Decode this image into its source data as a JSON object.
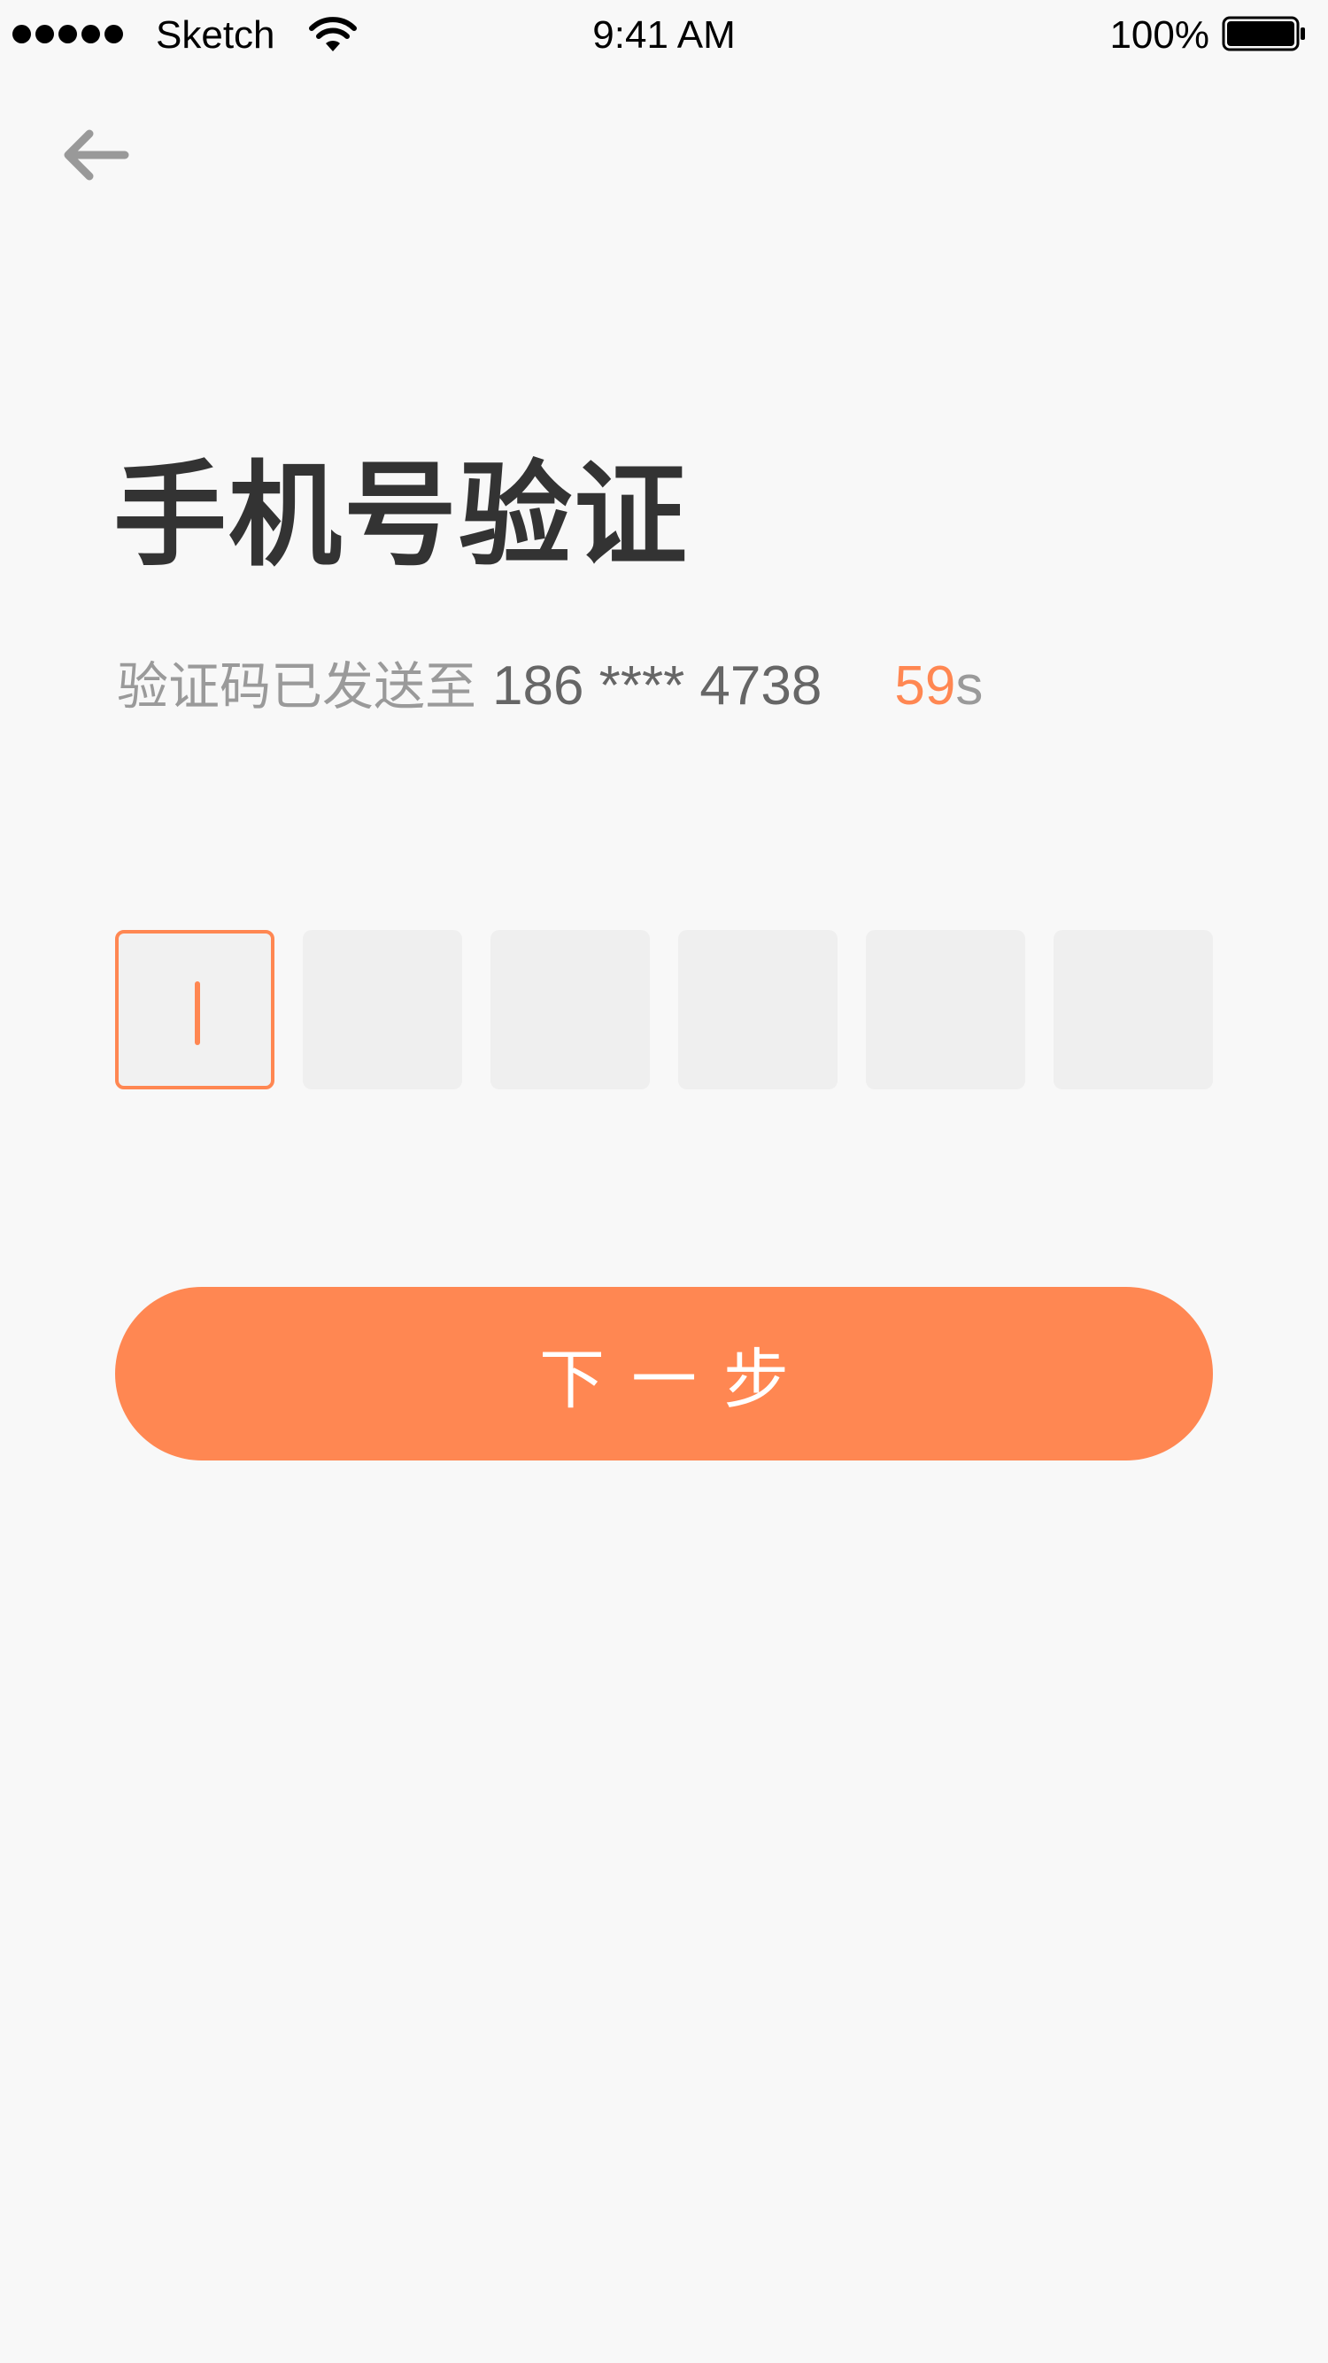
{
  "status_bar": {
    "carrier": "Sketch",
    "time": "9:41 AM",
    "battery": "100%",
    "signal_icon": "signal-dots-icon",
    "wifi_icon": "wifi-icon",
    "battery_icon": "battery-icon"
  },
  "nav": {
    "back_icon": "back-arrow-icon"
  },
  "header": {
    "title": "手机号验证",
    "subtitle_prefix": "验证码已发送至",
    "phone": "186 **** 4738",
    "countdown_value": "59",
    "countdown_unit": "s"
  },
  "code_input": {
    "length": 6,
    "active_index": 0,
    "values": [
      "",
      "",
      "",
      "",
      "",
      ""
    ]
  },
  "actions": {
    "next_label": "下一步"
  },
  "colors": {
    "accent": "#ff8752",
    "title": "#333333",
    "muted": "#9a9a9a",
    "phone": "#666666",
    "box": "#efefef",
    "background": "#f8f8f8"
  }
}
